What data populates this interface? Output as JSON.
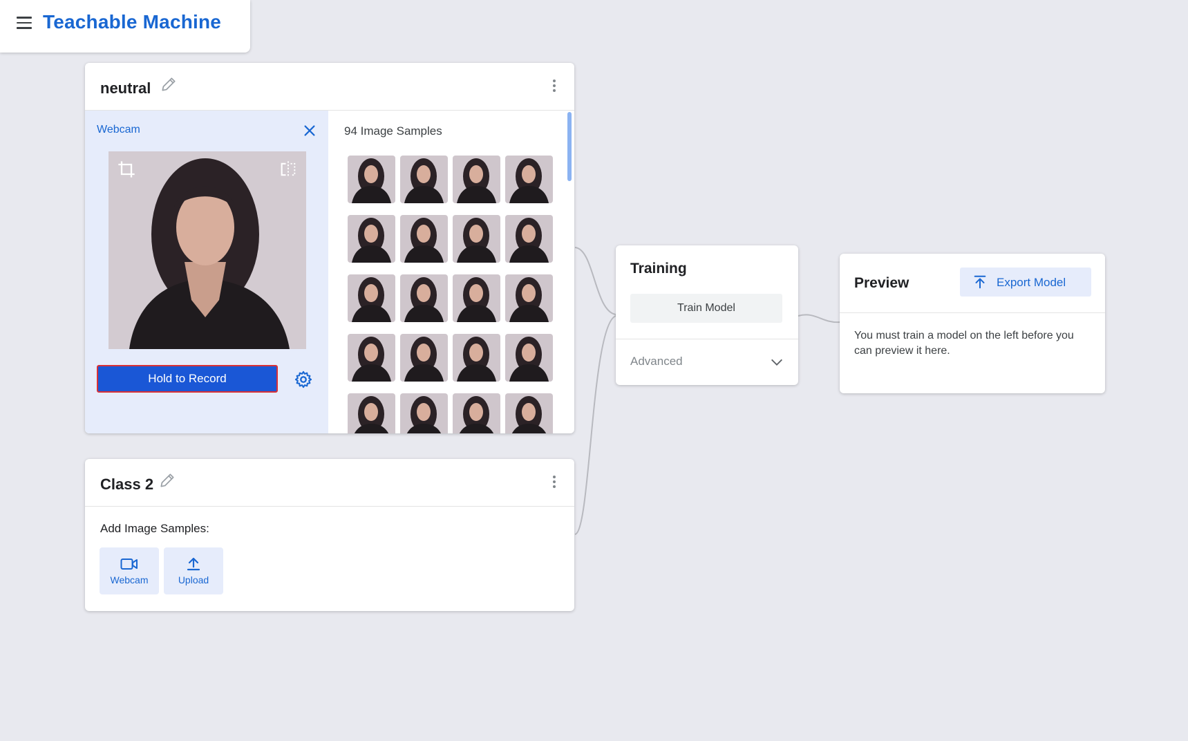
{
  "app": {
    "title": "Teachable Machine"
  },
  "classes": [
    {
      "name": "neutral",
      "webcam": {
        "label": "Webcam",
        "record_label": "Hold to Record"
      },
      "samples": {
        "count_label": "94 Image Samples"
      }
    },
    {
      "name": "Class 2",
      "add_samples": {
        "label": "Add Image Samples:",
        "webcam_label": "Webcam",
        "upload_label": "Upload"
      }
    }
  ],
  "training": {
    "title": "Training",
    "train_button": "Train Model",
    "advanced_label": "Advanced"
  },
  "preview": {
    "title": "Preview",
    "export_button": "Export Model",
    "message": "You must train a model on the left before you can preview it here."
  },
  "colors": {
    "accent": "#1967d2",
    "record": "#1a57d6",
    "record_border": "#d93036",
    "panel": "#e6ecfb",
    "background": "#e8e9ef"
  },
  "icons": [
    "menu-icon",
    "edit-icon",
    "kebab-menu-icon",
    "close-icon",
    "crop-icon",
    "flip-icon",
    "settings-icon",
    "video-camera-icon",
    "upload-icon",
    "chevron-down-icon",
    "export-icon"
  ]
}
